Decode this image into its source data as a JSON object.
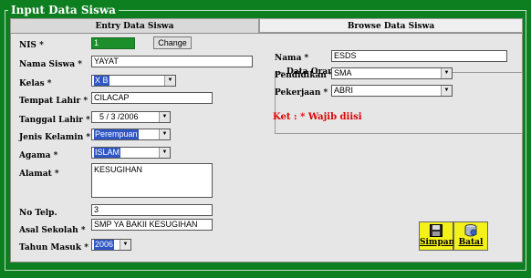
{
  "window": {
    "title": "Input Data Siswa"
  },
  "tabs": [
    {
      "label": "Entry Data Siswa",
      "active": true
    },
    {
      "label": "Browse Data Siswa",
      "active": false
    }
  ],
  "form": {
    "nis": {
      "label": "NIS *",
      "value": "1",
      "change_label": "Change"
    },
    "nama": {
      "label": "Nama Siswa *",
      "value": "YAYAT"
    },
    "kelas": {
      "label": "Kelas *",
      "value": "X B"
    },
    "tempat_lahir": {
      "label": "Tempat Lahir *",
      "value": "CILACAP"
    },
    "tanggal_lahir": {
      "label": "Tanggal Lahir *",
      "value": "5 / 3 /2006"
    },
    "jenis_kelamin": {
      "label": "Jenis Kelamin *",
      "value": "Perempuan"
    },
    "agama": {
      "label": "Agama *",
      "value": "ISLAM"
    },
    "alamat": {
      "label": "Alamat *",
      "value": "KESUGIHAN"
    },
    "no_telp": {
      "label": "No Telp.",
      "value": "3"
    },
    "asal_sekolah": {
      "label": "Asal Sekolah *",
      "value": "SMP YA BAKII KESUGIHAN"
    },
    "tahun_masuk": {
      "label": "Tahun Masuk *",
      "value": "2006"
    }
  },
  "orang_tua": {
    "title": "Data Orang Tua",
    "nama": {
      "label": "Nama *",
      "value": "ESDS"
    },
    "pendidikan": {
      "label": "Pendidikan *",
      "value": "SMA"
    },
    "pekerjaan": {
      "label": "Pekerjaan *",
      "value": "ABRI"
    }
  },
  "note": "Ket :  *  Wajib diisi",
  "buttons": {
    "simpan": "Simpan",
    "batal": "Batal"
  },
  "colors": {
    "background": "#0e7f20",
    "panel": "#e6e6e6",
    "note": "#e00000",
    "action_button": "#f3f01a",
    "highlight": "#2e57c5"
  },
  "icons": {
    "simpan": "floppy-disk-icon",
    "batal": "database-icon"
  }
}
